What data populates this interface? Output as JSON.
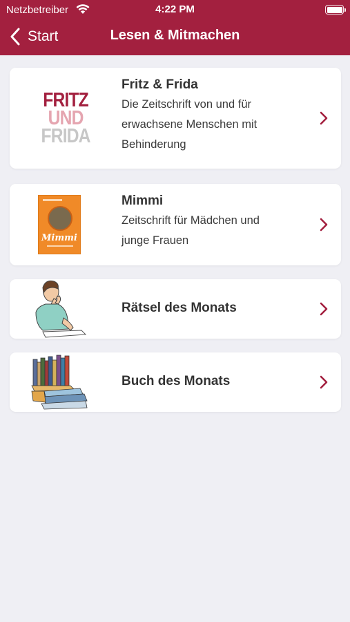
{
  "status_bar": {
    "carrier": "Netzbetreiber",
    "time": "4:22 PM",
    "wifi_icon": "wifi-icon",
    "battery_icon": "battery-icon"
  },
  "nav": {
    "back_label": "Start",
    "title": "Lesen & Mitmachen",
    "bar_color": "#a3203f"
  },
  "items": [
    {
      "title": "Fritz & Frida",
      "description_lines": [
        "Die Zeitschrift von und für",
        "erwachsene Menschen mit",
        "Behinderung"
      ],
      "logo_lines": [
        "FRITZ",
        "UND",
        "FRIDA"
      ],
      "icon": "fritz-frida-logo"
    },
    {
      "title": "Mimmi",
      "description_lines": [
        "Zeitschrift für Mädchen und",
        "junge Frauen"
      ],
      "cover_text": "Mimmi",
      "icon": "mimmi-cover-image"
    },
    {
      "title": "Rätsel des Monats",
      "icon": "thinking-person-icon"
    },
    {
      "title": "Buch des Monats",
      "icon": "books-stack-icon"
    }
  ],
  "colors": {
    "accent": "#a3203f",
    "background": "#efeff4",
    "card": "#ffffff"
  }
}
